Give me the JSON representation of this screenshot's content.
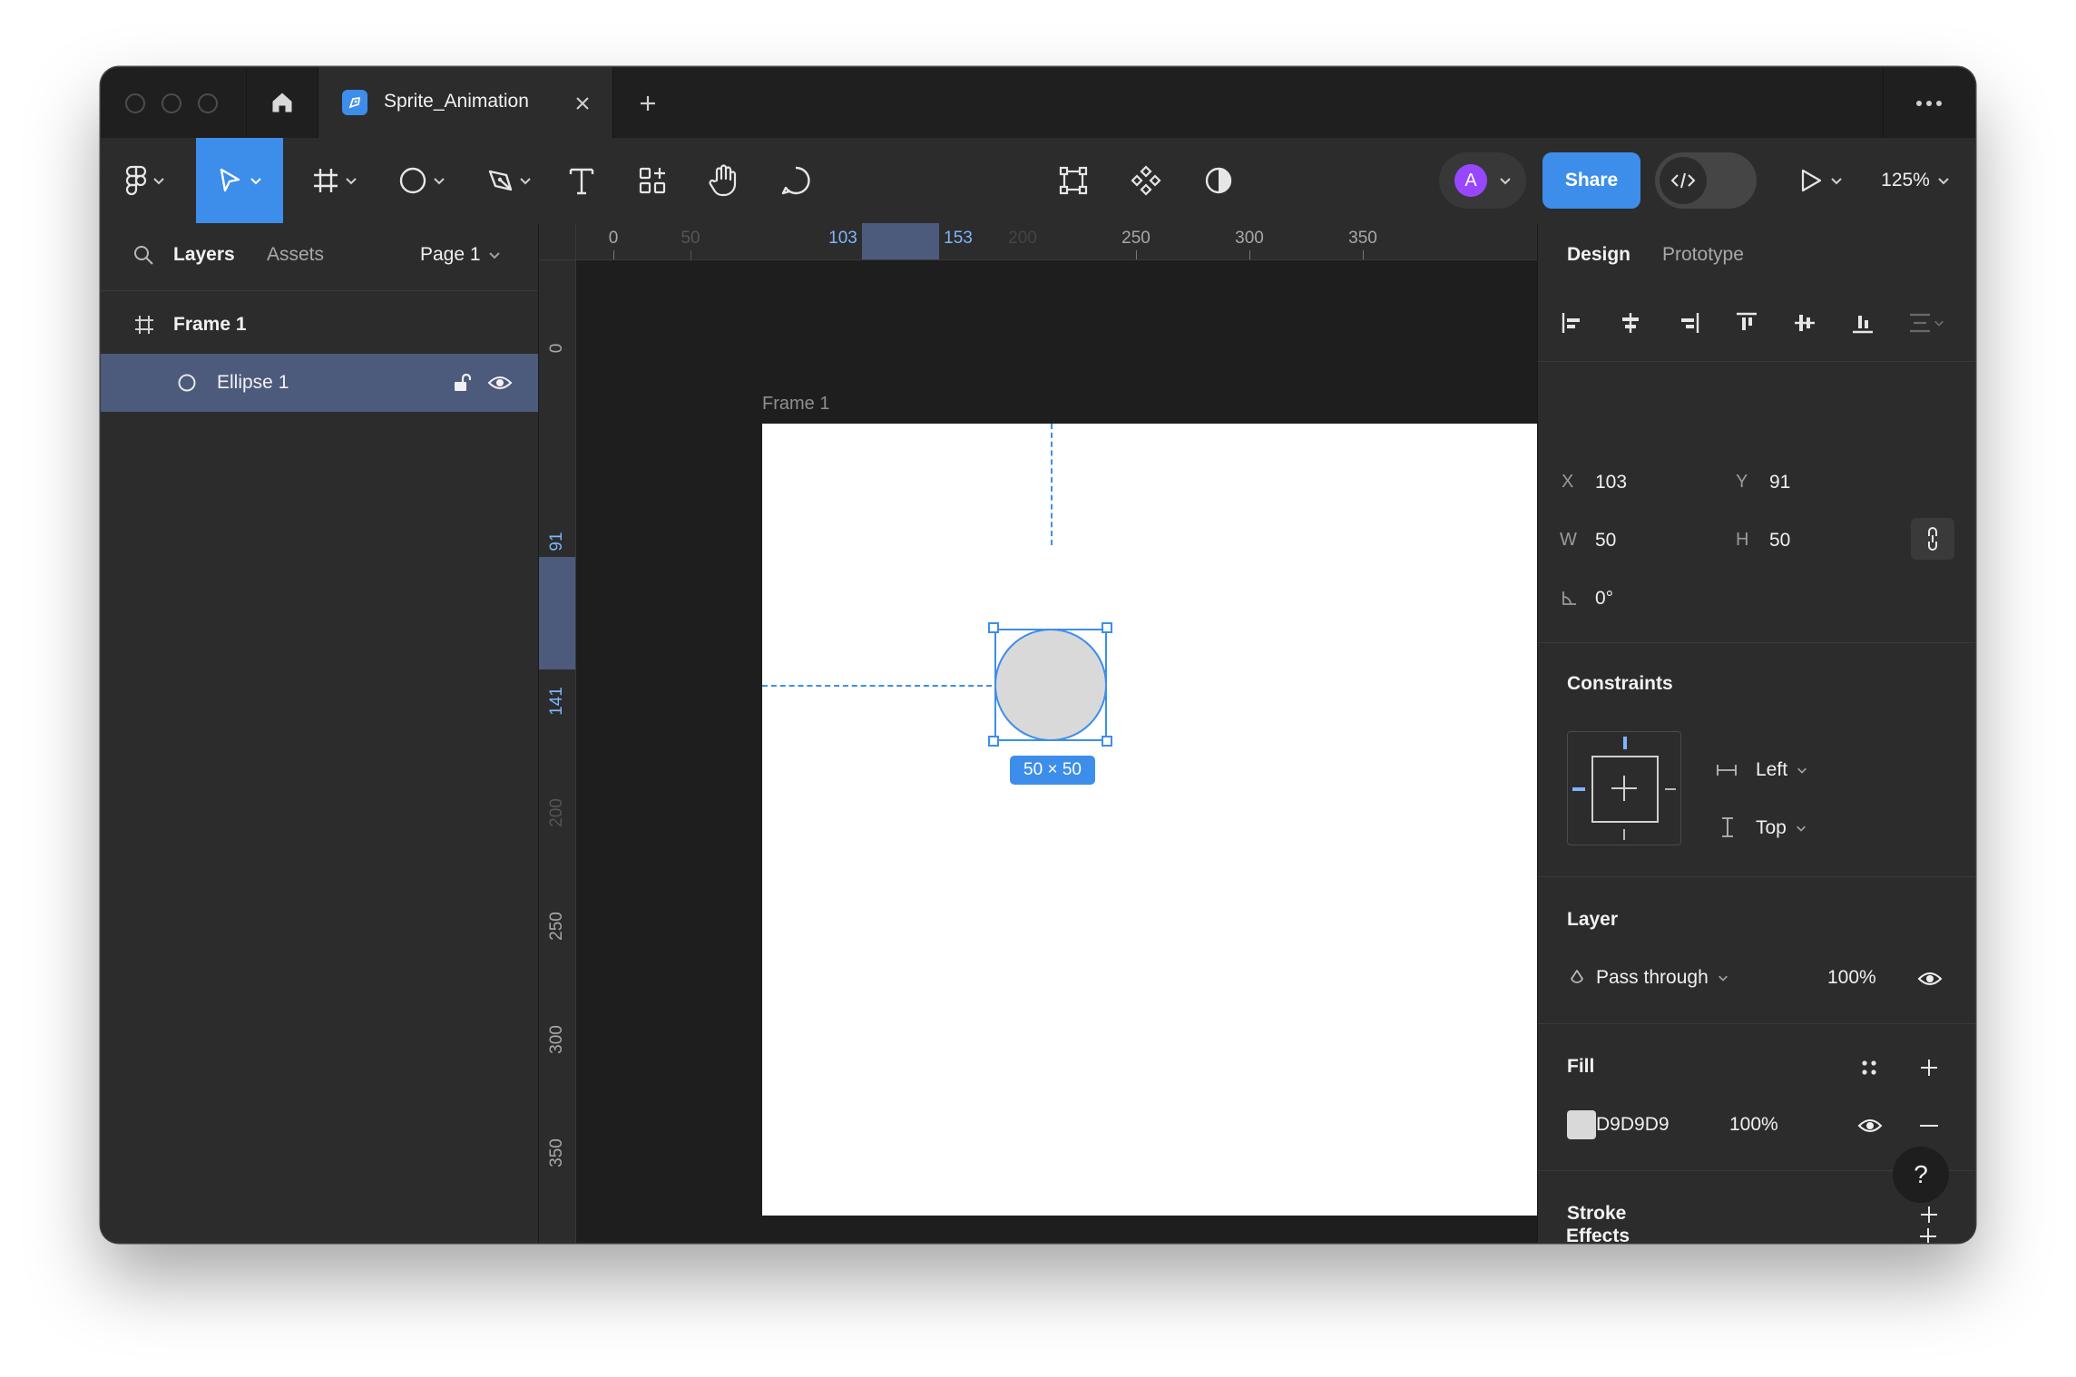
{
  "tabs": {
    "file_title": "Sprite_Animation"
  },
  "toolbar": {
    "share_label": "Share",
    "avatar_initial": "A",
    "zoom": "125%"
  },
  "left_panel": {
    "tab_layers": "Layers",
    "tab_assets": "Assets",
    "page_selector": "Page 1",
    "layers": [
      {
        "name": "Frame 1"
      },
      {
        "name": "Ellipse 1"
      }
    ]
  },
  "rulers": {
    "top": [
      "0",
      "50",
      "103",
      "153",
      "200",
      "250",
      "300",
      "350"
    ],
    "left": [
      "0",
      "91",
      "141",
      "200",
      "250",
      "300",
      "350"
    ]
  },
  "canvas": {
    "frame_label": "Frame 1",
    "size_badge": "50 × 50",
    "ellipse_fill": "#D9D9D9",
    "selection_color": "#3d8eea"
  },
  "design": {
    "tab_design": "Design",
    "tab_prototype": "Prototype",
    "x_label": "X",
    "x_value": "103",
    "y_label": "Y",
    "y_value": "91",
    "w_label": "W",
    "w_value": "50",
    "h_label": "H",
    "h_value": "50",
    "rotation_value": "0°",
    "constraints_title": "Constraints",
    "constraint_h": "Left",
    "constraint_v": "Top",
    "layer_title": "Layer",
    "blend_mode": "Pass through",
    "layer_opacity": "100%",
    "fill_title": "Fill",
    "fill_hex": "D9D9D9",
    "fill_opacity": "100%",
    "stroke_title": "Stroke",
    "effects_title": "Effects",
    "help_label": "?"
  }
}
